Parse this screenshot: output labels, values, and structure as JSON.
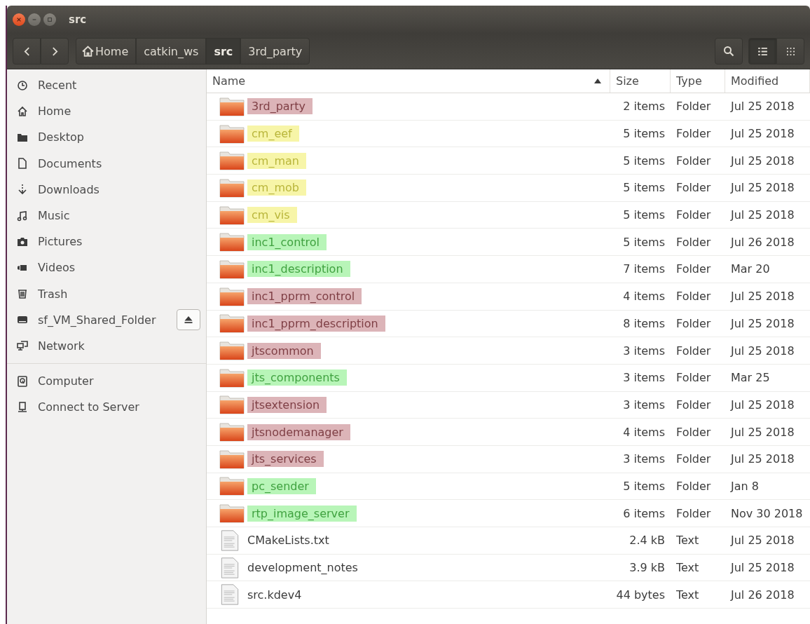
{
  "window": {
    "title": "src"
  },
  "pathbar": [
    {
      "label": "Home",
      "selected": false,
      "kind": "home"
    },
    {
      "label": "catkin_ws",
      "selected": false,
      "kind": "dir"
    },
    {
      "label": "src",
      "selected": true,
      "kind": "dir"
    },
    {
      "label": "3rd_party",
      "selected": false,
      "kind": "dir"
    }
  ],
  "view_buttons": [
    {
      "kind": "list",
      "selected": true
    },
    {
      "kind": "grid",
      "selected": false
    }
  ],
  "sidebar": {
    "groups": [
      [
        {
          "label": "Recent",
          "mounted": false
        },
        {
          "label": "Home",
          "mounted": false
        },
        {
          "label": "Desktop",
          "mounted": false
        },
        {
          "label": "Documents",
          "mounted": false
        },
        {
          "label": "Downloads",
          "mounted": false
        },
        {
          "label": "Music",
          "mounted": false
        },
        {
          "label": "Pictures",
          "mounted": false
        },
        {
          "label": "Videos",
          "mounted": false
        },
        {
          "label": "Trash",
          "mounted": false
        },
        {
          "label": "sf_VM_Shared_Folder",
          "mounted": true
        },
        {
          "label": "Network",
          "mounted": false
        }
      ],
      [
        {
          "label": "Computer",
          "mounted": false
        },
        {
          "label": "Connect to Server",
          "mounted": false
        }
      ]
    ]
  },
  "table": {
    "columns": [
      {
        "label": "Name",
        "sorted": true
      },
      {
        "label": "Size",
        "sorted": false
      },
      {
        "label": "Type",
        "sorted": false
      },
      {
        "label": "Modified",
        "sorted": false
      }
    ],
    "rows": [
      {
        "kind": "folder",
        "name": "3rd_party",
        "size": "2 items",
        "type": "Folder",
        "modified": "Jul 25 2018",
        "color": "#dcb4b8"
      },
      {
        "kind": "folder",
        "name": "cm_eef",
        "size": "5 items",
        "type": "Folder",
        "modified": "Jul 25 2018",
        "color": "#f7f5a8"
      },
      {
        "kind": "folder",
        "name": "cm_man",
        "size": "5 items",
        "type": "Folder",
        "modified": "Jul 25 2018",
        "color": "#f7f5a8"
      },
      {
        "kind": "folder",
        "name": "cm_mob",
        "size": "5 items",
        "type": "Folder",
        "modified": "Jul 25 2018",
        "color": "#f7f5a8"
      },
      {
        "kind": "folder",
        "name": "cm_vis",
        "size": "5 items",
        "type": "Folder",
        "modified": "Jul 25 2018",
        "color": "#f7f5a8"
      },
      {
        "kind": "folder",
        "name": "inc1_control",
        "size": "5 items",
        "type": "Folder",
        "modified": "Jul 26 2018",
        "color": "#b8f5b8"
      },
      {
        "kind": "folder",
        "name": "inc1_description",
        "size": "7 items",
        "type": "Folder",
        "modified": "Mar 20",
        "color": "#b8f5b8"
      },
      {
        "kind": "folder",
        "name": "inc1_pprm_control",
        "size": "4 items",
        "type": "Folder",
        "modified": "Jul 25 2018",
        "color": "#dcb4b8"
      },
      {
        "kind": "folder",
        "name": "inc1_pprm_description",
        "size": "8 items",
        "type": "Folder",
        "modified": "Jul 25 2018",
        "color": "#dcb4b8"
      },
      {
        "kind": "folder",
        "name": "jtscommon",
        "size": "3 items",
        "type": "Folder",
        "modified": "Jul 25 2018",
        "color": "#dcb4b8"
      },
      {
        "kind": "folder",
        "name": "jts_components",
        "size": "3 items",
        "type": "Folder",
        "modified": "Mar 25",
        "color": "#b8f5b8"
      },
      {
        "kind": "folder",
        "name": "jtsextension",
        "size": "3 items",
        "type": "Folder",
        "modified": "Jul 25 2018",
        "color": "#dcb4b8"
      },
      {
        "kind": "folder",
        "name": "jtsnodemanager",
        "size": "4 items",
        "type": "Folder",
        "modified": "Jul 25 2018",
        "color": "#dcb4b8"
      },
      {
        "kind": "folder",
        "name": "jts_services",
        "size": "3 items",
        "type": "Folder",
        "modified": "Jul 25 2018",
        "color": "#dcb4b8"
      },
      {
        "kind": "folder",
        "name": "pc_sender",
        "size": "5 items",
        "type": "Folder",
        "modified": "Jan 8",
        "color": "#b8f5b8"
      },
      {
        "kind": "folder",
        "name": "rtp_image_server",
        "size": "6 items",
        "type": "Folder",
        "modified": "Nov 30 2018",
        "color": "#b8f5b8"
      },
      {
        "kind": "file",
        "name": "CMakeLists.txt",
        "size": "2.4 kB",
        "type": "Text",
        "modified": "Jul 25 2018"
      },
      {
        "kind": "file",
        "name": "development_notes",
        "size": "3.9 kB",
        "type": "Text",
        "modified": "Jul 25 2018"
      },
      {
        "kind": "file",
        "name": "src.kdev4",
        "size": "44 bytes",
        "type": "Text",
        "modified": "Jul 26 2018"
      }
    ]
  }
}
